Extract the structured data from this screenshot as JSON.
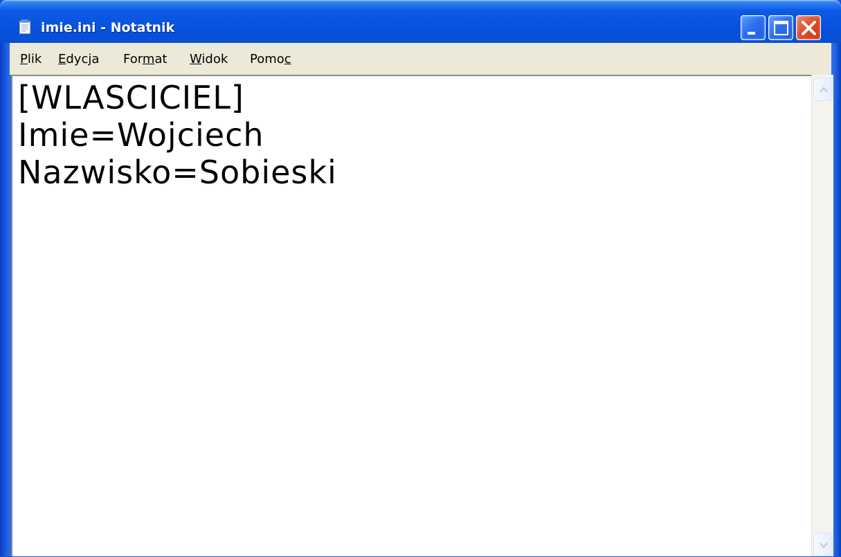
{
  "window": {
    "title": "imie.ini - Notatnik",
    "icon": "notepad-icon"
  },
  "caption_buttons": {
    "minimize_icon": "minimize-icon",
    "maximize_icon": "maximize-icon",
    "close_icon": "close-icon"
  },
  "menu": {
    "items": [
      {
        "label_pre": "",
        "label_ul": "P",
        "label_post": "lik"
      },
      {
        "label_pre": "",
        "label_ul": "E",
        "label_post": "dycja"
      },
      {
        "label_pre": "For",
        "label_ul": "m",
        "label_post": "at"
      },
      {
        "label_pre": "",
        "label_ul": "W",
        "label_post": "idok"
      },
      {
        "label_pre": "Pomo",
        "label_ul": "c",
        "label_post": ""
      }
    ]
  },
  "editor": {
    "content": "[WLASCICIEL]\nImie=Wojciech\nNazwisko=Sobieski"
  },
  "colors": {
    "titlebar": "#0a54e0",
    "close_button": "#e0502c",
    "menubar": "#ece9d8",
    "editor_bg": "#ffffff"
  }
}
